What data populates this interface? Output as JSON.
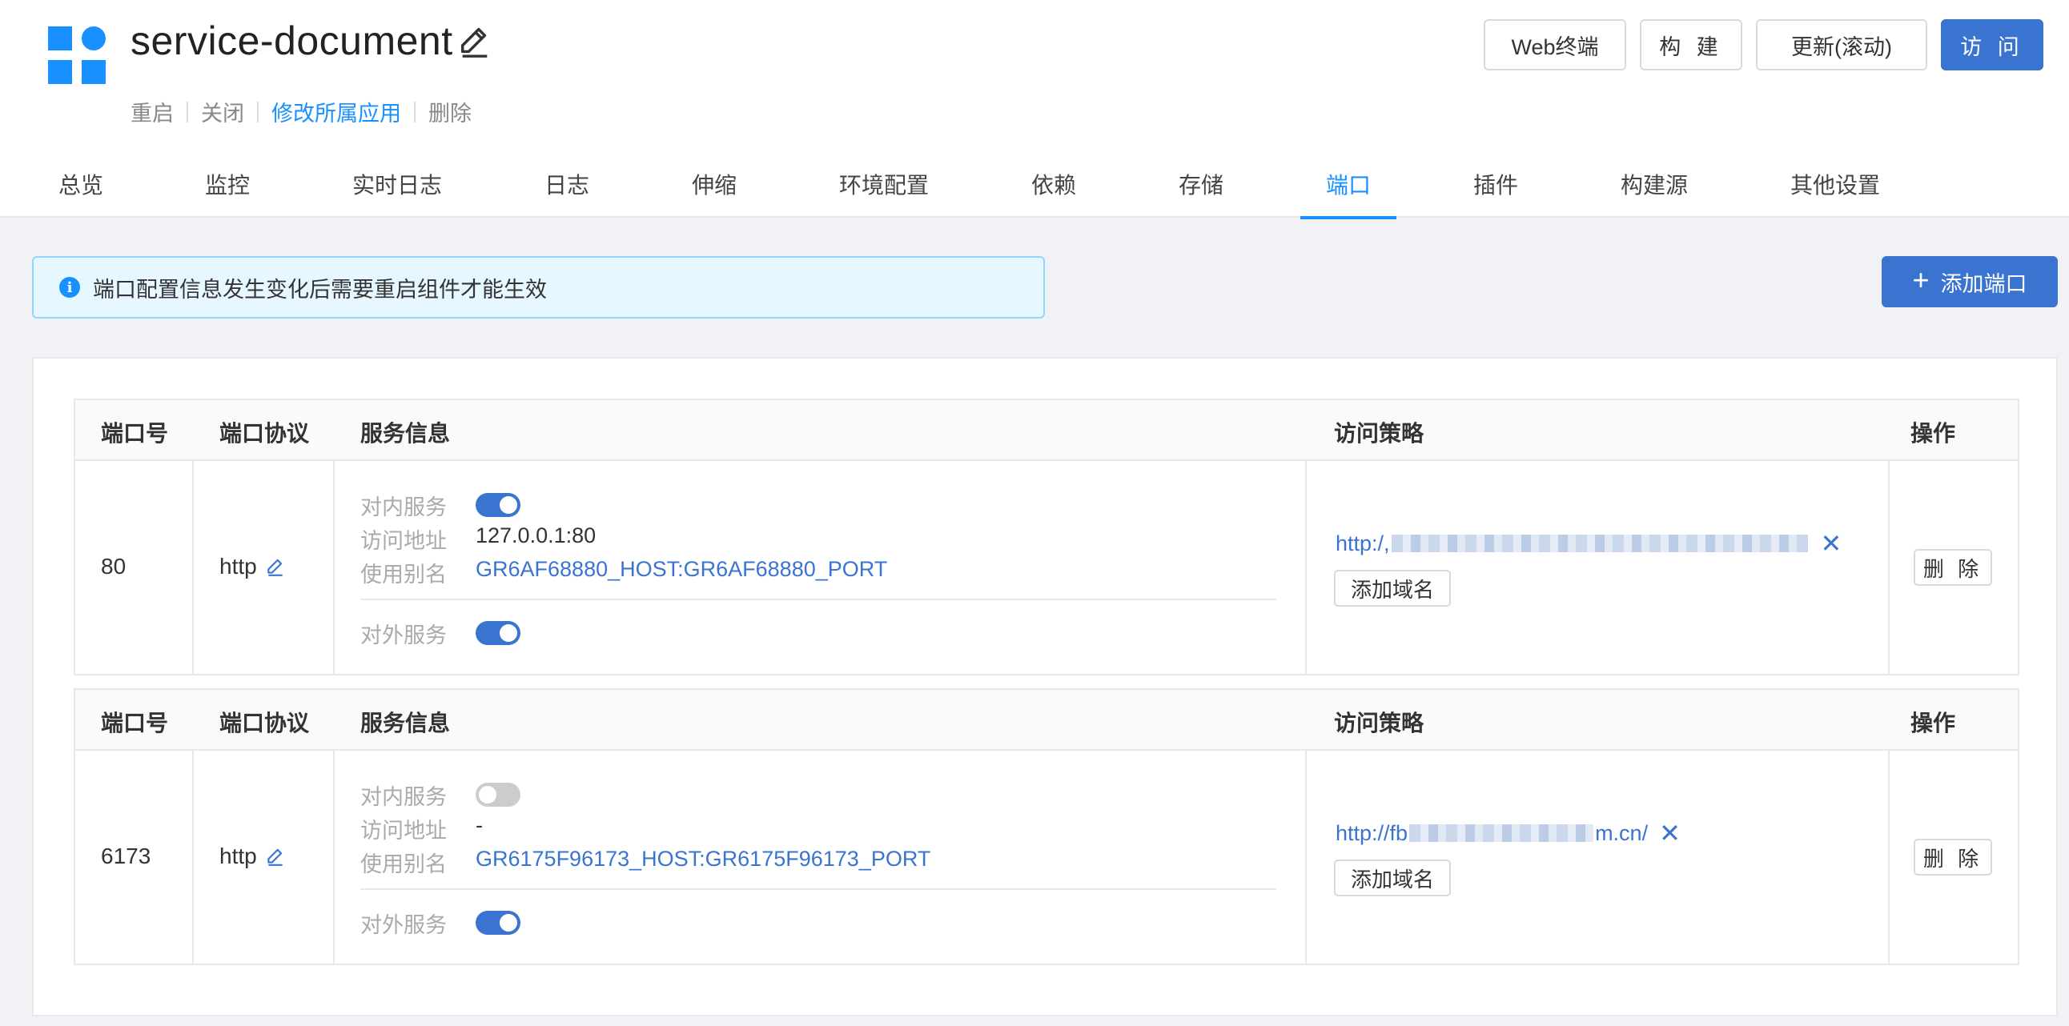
{
  "header": {
    "title": "service-document",
    "actions": {
      "restart": "重启",
      "close": "关闭",
      "modify_app": "修改所属应用",
      "delete": "删除"
    },
    "buttons": {
      "web_terminal": "Web终端",
      "build": "构 建",
      "update": "更新(滚动)",
      "visit": "访 问"
    }
  },
  "tabs": [
    {
      "label": "总览"
    },
    {
      "label": "监控"
    },
    {
      "label": "实时日志"
    },
    {
      "label": "日志"
    },
    {
      "label": "伸缩"
    },
    {
      "label": "环境配置"
    },
    {
      "label": "依赖"
    },
    {
      "label": "存储"
    },
    {
      "label": "端口",
      "active": true
    },
    {
      "label": "插件"
    },
    {
      "label": "构建源"
    },
    {
      "label": "其他设置"
    }
  ],
  "notice": {
    "text": "端口配置信息发生变化后需要重启组件才能生效"
  },
  "add_port_label": "添加端口",
  "columns": {
    "port": "端口号",
    "protocol": "端口协议",
    "service": "服务信息",
    "access": "访问策略",
    "ops": "操作"
  },
  "labels": {
    "inner_service": "对内服务",
    "access_addr": "访问地址",
    "alias": "使用别名",
    "outer_service": "对外服务",
    "add_domain": "添加域名",
    "delete": "删 除"
  },
  "ports": [
    {
      "port": "80",
      "protocol": "http",
      "inner_enabled": true,
      "access_addr": "127.0.0.1:80",
      "alias": "GR6AF68880_HOST:GR6AF68880_PORT",
      "outer_enabled": true,
      "url_prefix": "http:/,",
      "url_suffix": ""
    },
    {
      "port": "6173",
      "protocol": "http",
      "inner_enabled": false,
      "access_addr": "-",
      "alias": "GR6175F96173_HOST:GR6175F96173_PORT",
      "outer_enabled": true,
      "url_prefix": "http://fb",
      "url_suffix": "m.cn/"
    }
  ],
  "colors": {
    "primary": "#3a74d0",
    "accent": "#1890ff"
  }
}
